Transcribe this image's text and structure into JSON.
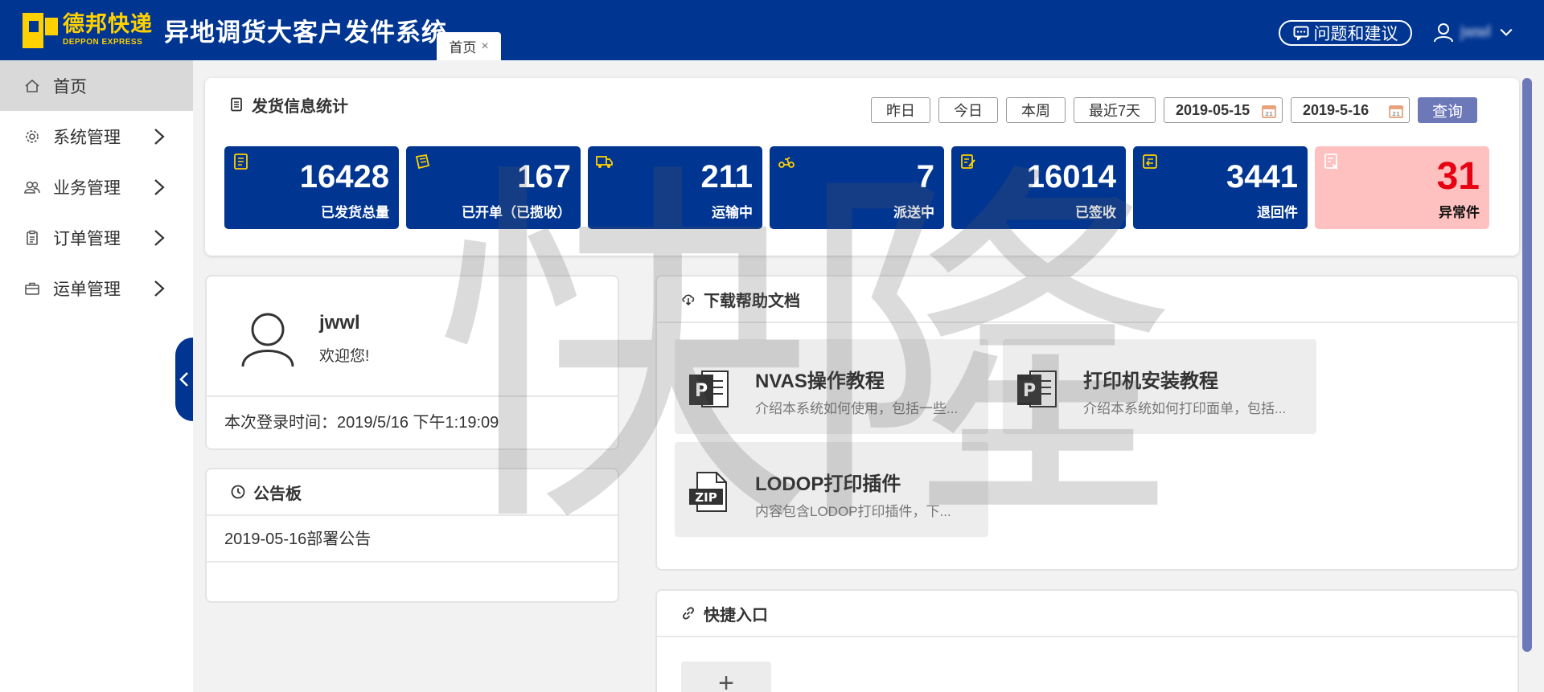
{
  "header": {
    "logo_cn": "德邦快递",
    "logo_en": "DEPPON EXPRESS",
    "system_title": "异地调货大客户发件系统",
    "tab_label": "首页",
    "tab_close": "×",
    "feedback_label": "问题和建议",
    "username": "jwwl"
  },
  "sidebar": {
    "items": [
      {
        "label": "首页",
        "icon": "home-icon"
      },
      {
        "label": "系统管理",
        "icon": "gear-icon"
      },
      {
        "label": "业务管理",
        "icon": "users-icon"
      },
      {
        "label": "订单管理",
        "icon": "clipboard-icon"
      },
      {
        "label": "运单管理",
        "icon": "briefcase-icon"
      }
    ]
  },
  "stats": {
    "title": "发货信息统计",
    "date_buttons": [
      "昨日",
      "今日",
      "本周",
      "最近7天"
    ],
    "date_from": "2019-05-15",
    "date_to": "2019-5-16",
    "query_label": "查询",
    "cards": [
      {
        "value": "16428",
        "label": "已发货总量"
      },
      {
        "value": "167",
        "label": "已开单（已揽收）"
      },
      {
        "value": "211",
        "label": "运输中"
      },
      {
        "value": "7",
        "label": "派送中"
      },
      {
        "value": "16014",
        "label": "已签收"
      },
      {
        "value": "3441",
        "label": "退回件"
      },
      {
        "value": "31",
        "label": "异常件"
      }
    ]
  },
  "user_panel": {
    "username": "jwwl",
    "welcome": "欢迎您!",
    "login_time": "本次登录时间：2019/5/16 下午1:19:09"
  },
  "notice": {
    "title": "公告板",
    "items": [
      "2019-05-16部署公告"
    ]
  },
  "downloads": {
    "title": "下载帮助文档",
    "docs": [
      {
        "title": "NVAS操作教程",
        "desc": "介绍本系统如何使用，包括一些...",
        "icon": "ppt-icon"
      },
      {
        "title": "打印机安装教程",
        "desc": "介绍本系统如何打印面单，包括...",
        "icon": "ppt-icon"
      },
      {
        "title": "LODOP打印插件",
        "desc": "内容包含LODOP打印插件，下...",
        "icon": "zip-icon"
      }
    ]
  },
  "shortcuts": {
    "title": "快捷入口",
    "add_label": "+"
  },
  "watermark": "快隆",
  "colors": {
    "brand_blue": "#003591",
    "brand_yellow": "#ffd100",
    "query_button": "#6d78b9",
    "warn_card": "#ffc0c0",
    "warn_value": "#e60012"
  }
}
